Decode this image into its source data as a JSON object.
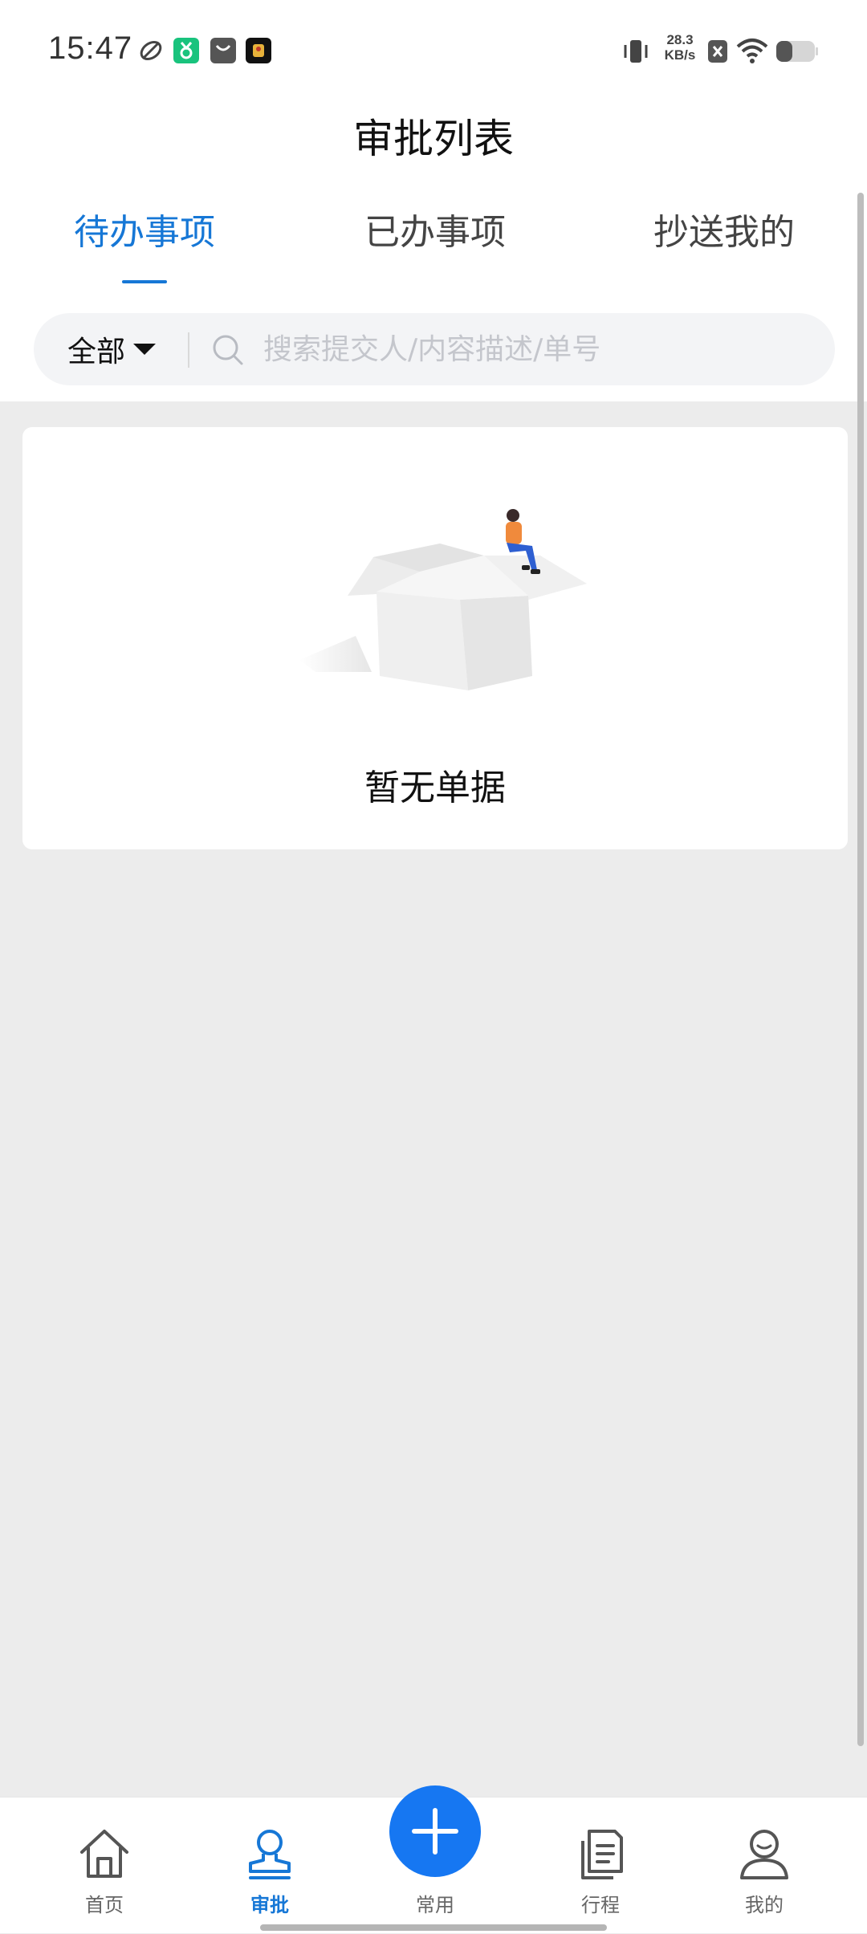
{
  "status_bar": {
    "time": "15:47",
    "network_speed": "28.3",
    "network_speed_unit": "KB/s",
    "icons": [
      "app-icon",
      "wechat-icon",
      "bag-icon",
      "app-icon",
      "vibrate-icon",
      "notification-off-icon",
      "wifi-icon",
      "battery-icon"
    ]
  },
  "header": {
    "title": "审批列表"
  },
  "tabs": [
    {
      "label": "待办事项",
      "active": true
    },
    {
      "label": "已办事项",
      "active": false
    },
    {
      "label": "抄送我的",
      "active": false
    }
  ],
  "filter": {
    "selected": "全部",
    "search_placeholder": "搜索提交人/内容描述/单号",
    "search_value": ""
  },
  "empty_state": {
    "message": "暂无单据"
  },
  "bottom_nav": {
    "items": [
      {
        "label": "首页",
        "icon": "home-icon",
        "active": false
      },
      {
        "label": "审批",
        "icon": "approve-stamp-icon",
        "active": true
      },
      {
        "label": "常用",
        "icon": "plus-icon",
        "active": false
      },
      {
        "label": "行程",
        "icon": "document-icon",
        "active": false
      },
      {
        "label": "我的",
        "icon": "user-icon",
        "active": false
      }
    ]
  },
  "colors": {
    "accent": "#1677d6",
    "fab": "#1677f2",
    "background": "#ececec"
  }
}
